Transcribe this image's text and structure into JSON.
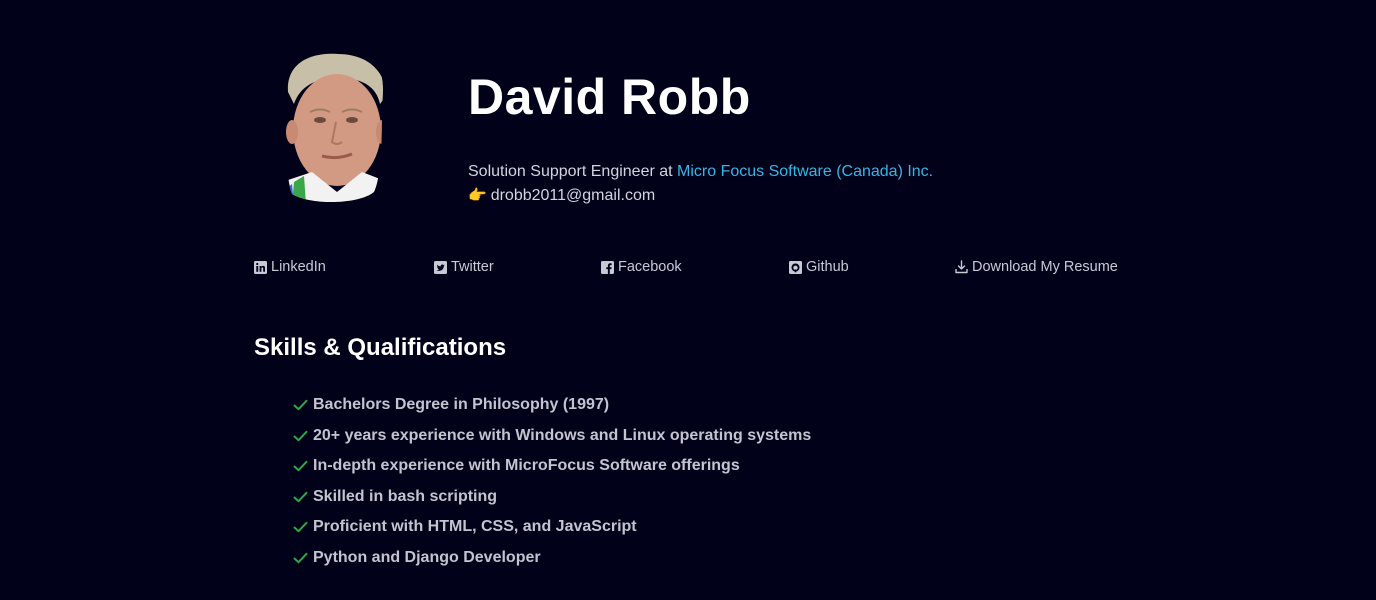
{
  "profile": {
    "name": "David Robb",
    "role_prefix": "Solution Support Engineer at ",
    "company": "Micro Focus Software (Canada) Inc.",
    "email_emoji": "👉",
    "email": "drobb2011@gmail.com"
  },
  "links": {
    "linkedin": "LinkedIn",
    "twitter": "Twitter",
    "facebook": "Facebook",
    "github": "Github",
    "resume": "Download My Resume"
  },
  "skills": {
    "title": "Skills & Qualifications",
    "items": [
      "Bachelors Degree in Philosophy (1997)",
      "20+ years experience with Windows and Linux operating systems",
      "In-depth experience with MicroFocus Software offerings",
      "Skilled in bash scripting",
      "Proficient with HTML, CSS, and JavaScript",
      "Python and Django Developer"
    ]
  },
  "colors": {
    "background": "#02011a",
    "accent_link": "#35b6e6",
    "check_green": "#2fa84a"
  }
}
